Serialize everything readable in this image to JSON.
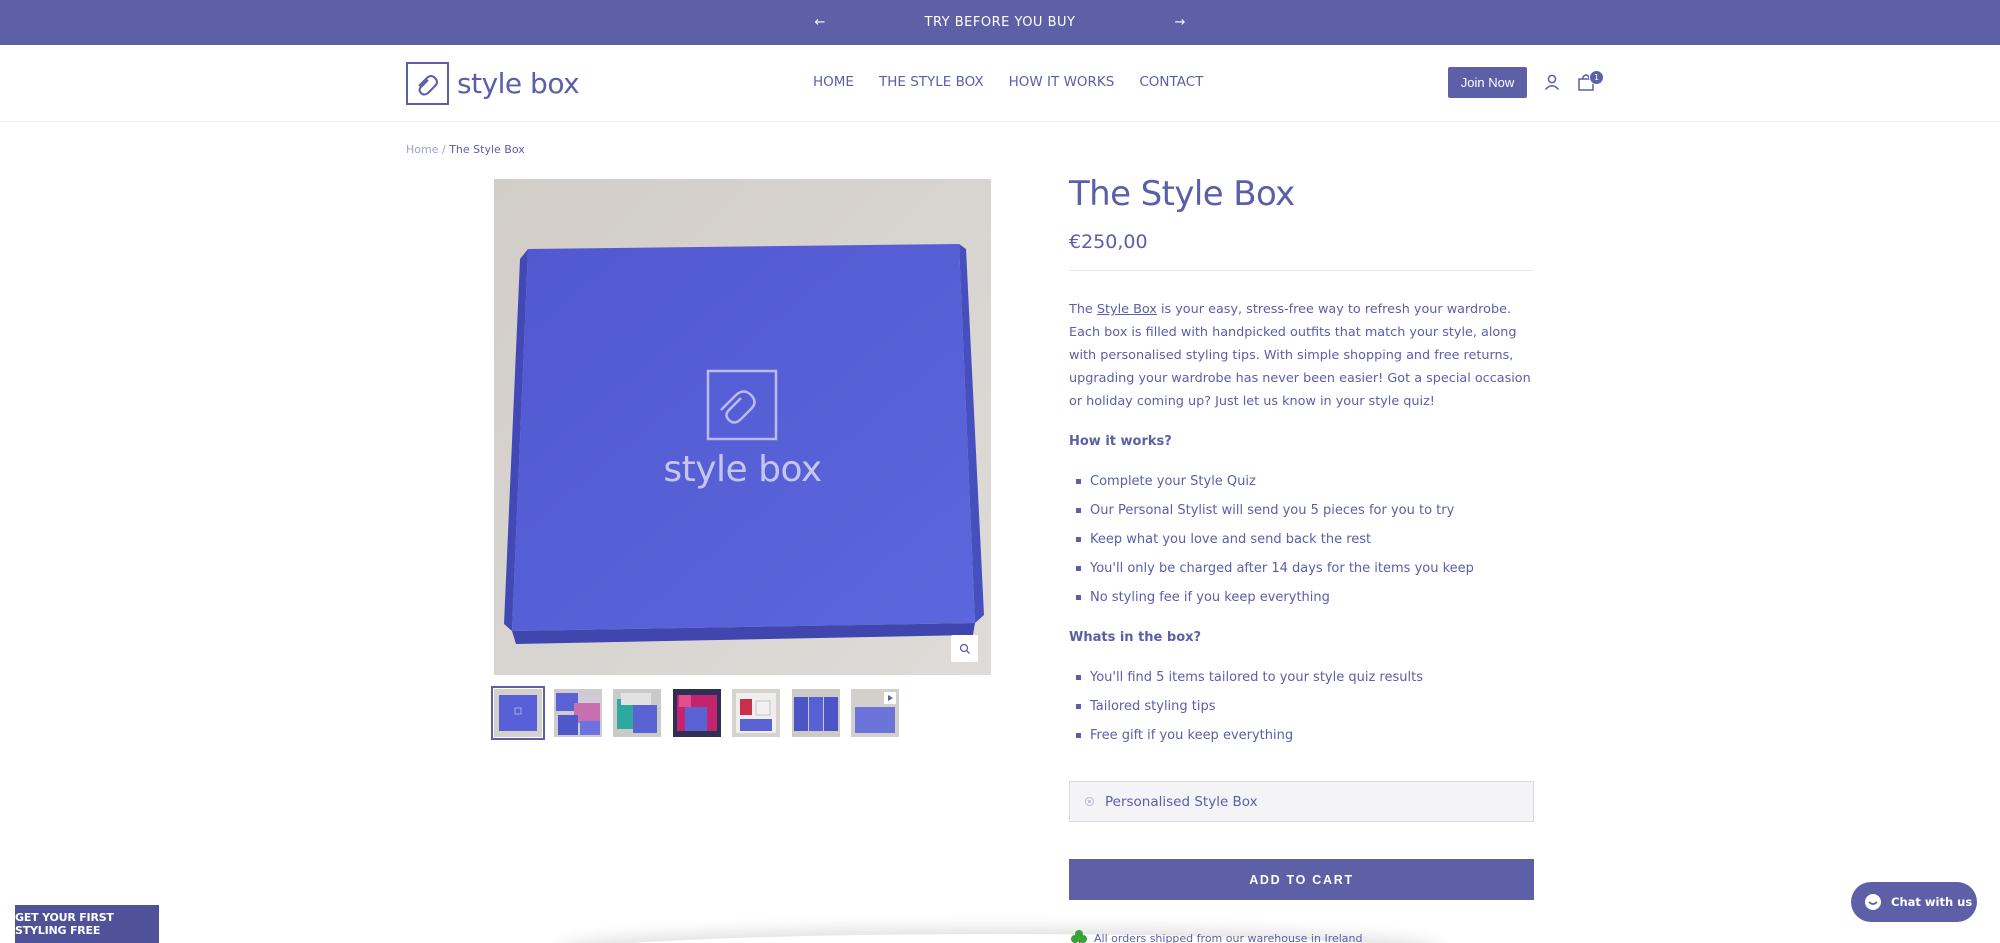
{
  "announcement": {
    "text": "TRY BEFORE YOU BUY",
    "prev": "←",
    "next": "→"
  },
  "header": {
    "logo_text": "style box",
    "nav": [
      "HOME",
      "THE STYLE BOX",
      "HOW IT WORKS",
      "CONTACT"
    ],
    "join_label": "Join Now",
    "cart_count": "1"
  },
  "breadcrumb": {
    "home": "Home",
    "sep": "/",
    "current": "The Style Box"
  },
  "gallery": {
    "box_text": "style box",
    "thumb_count": 7,
    "active_thumb": 0
  },
  "product": {
    "title": "The Style Box",
    "price": "€250,00",
    "desc_intro": "The ",
    "desc_link": "Style Box",
    "desc_rest": " is your easy, stress-free way to refresh your wardrobe. Each box is filled with handpicked outfits that match your style, along with personalised styling tips. With simple shopping and free returns, upgrading your wardrobe has never been easier! Got a special occasion or holiday coming up? Just let us know in your style quiz!",
    "how_heading": "How it works?",
    "how_items": [
      "Complete your Style Quiz",
      "Our Personal Stylist will send you 5 pieces for you to try",
      "Keep what you love and send back the rest",
      "You'll only be charged after 14 days for the items you keep",
      "No styling fee if you keep everything"
    ],
    "box_heading": "Whats in the box?",
    "box_items": [
      "You'll find 5 items tailored to your style quiz results",
      "Tailored styling tips",
      "Free gift if you keep everything"
    ],
    "variant_label": "Personalised Style Box",
    "add_to_cart": "ADD TO CART",
    "shipping": "All orders shipped from our warehouse in Ireland"
  },
  "promo_label": "GET YOUR FIRST STYLING FREE",
  "chat_label": "Chat with us",
  "colors": {
    "brand": "#5d60a6",
    "text": "#5a5fa8",
    "box": "#5b62d2"
  }
}
